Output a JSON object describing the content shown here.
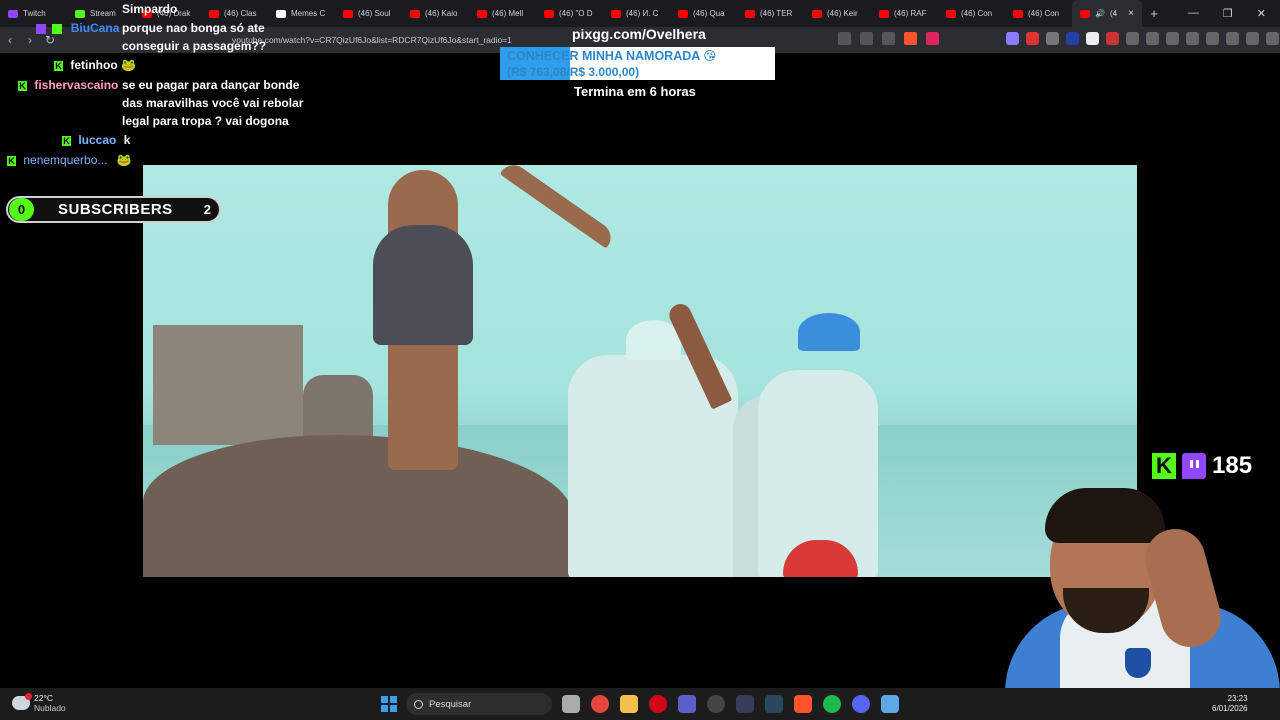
{
  "browser": {
    "tabs": [
      {
        "label": "Twitch",
        "color": "#9146ff"
      },
      {
        "label": "Stream",
        "color": "#53fc18"
      },
      {
        "label": "(46) Drak",
        "color": "#ff0000"
      },
      {
        "label": "(46) Clas",
        "color": "#ff0000"
      },
      {
        "label": "Memes C",
        "color": "#ffffff"
      },
      {
        "label": "(46) Soul",
        "color": "#ff0000"
      },
      {
        "label": "(46) Kaio",
        "color": "#ff0000"
      },
      {
        "label": "(46) Mell",
        "color": "#ff0000"
      },
      {
        "label": "(46) \"O D",
        "color": "#ff0000"
      },
      {
        "label": "(46) И. С",
        "color": "#ff0000"
      },
      {
        "label": "(46) Qua",
        "color": "#ff0000"
      },
      {
        "label": "(46) TER",
        "color": "#ff0000"
      },
      {
        "label": "(46) Keir",
        "color": "#ff0000"
      },
      {
        "label": "(46) RAF",
        "color": "#ff0000"
      },
      {
        "label": "(46) Con",
        "color": "#ff0000"
      },
      {
        "label": "(46) Con",
        "color": "#ff0000"
      }
    ],
    "active_tab": {
      "label": "(4",
      "color": "#ff0000"
    },
    "new_tab_label": "+",
    "url": "youtube.com/watch?v=CR7QizUf6Jo&list=RDCR7QizUf6Jo&start_radio=1",
    "window_controls": {
      "minimize": "—",
      "restore": "❐",
      "close": "✕"
    }
  },
  "chat": {
    "messages": [
      {
        "user": "Simpardo",
        "user_color": "#ffffff",
        "text": ""
      },
      {
        "user": "BiuCana",
        "user_color": "#3d8bff",
        "text": "porque nao bonga só ate conseguir a passagem??"
      },
      {
        "user": "fetinhoo",
        "user_color": "#ffffff",
        "text": "🐸"
      },
      {
        "user": "fishervascaino",
        "user_color": "#ff9ec7",
        "text": "se eu pagar para dançar bonde das maravilhas você vai rebolar legal para tropa ? vai dogona"
      },
      {
        "user": "luccao",
        "user_color": "#7fb3ff",
        "text": "k"
      },
      {
        "user": "nenemquerbo...",
        "user_color": "#7fb3ff",
        "text": "🐸"
      }
    ]
  },
  "goal": {
    "title": "pixgg.com/Ovelhera",
    "label": "CONHECER MINHA NAMORADA 😘",
    "amount": "(R$ 763,08/R$ 3.000,00)",
    "progress": 0.2544,
    "ends": "Termina em 6 horas"
  },
  "subscribers": {
    "count": "0",
    "label": "SUBSCRIBERS",
    "goal": "2"
  },
  "viewers": {
    "kick_icon": "K",
    "count": "185"
  },
  "taskbar": {
    "weather_temp": "22°C",
    "weather_desc": "Nublado",
    "search_placeholder": "Pesquisar",
    "time": "23:23",
    "date": "6/01/2026"
  },
  "colors": {
    "kick_green": "#53fc18",
    "twitch_purple": "#9146ff",
    "goal_blue": "#2e9eea"
  }
}
